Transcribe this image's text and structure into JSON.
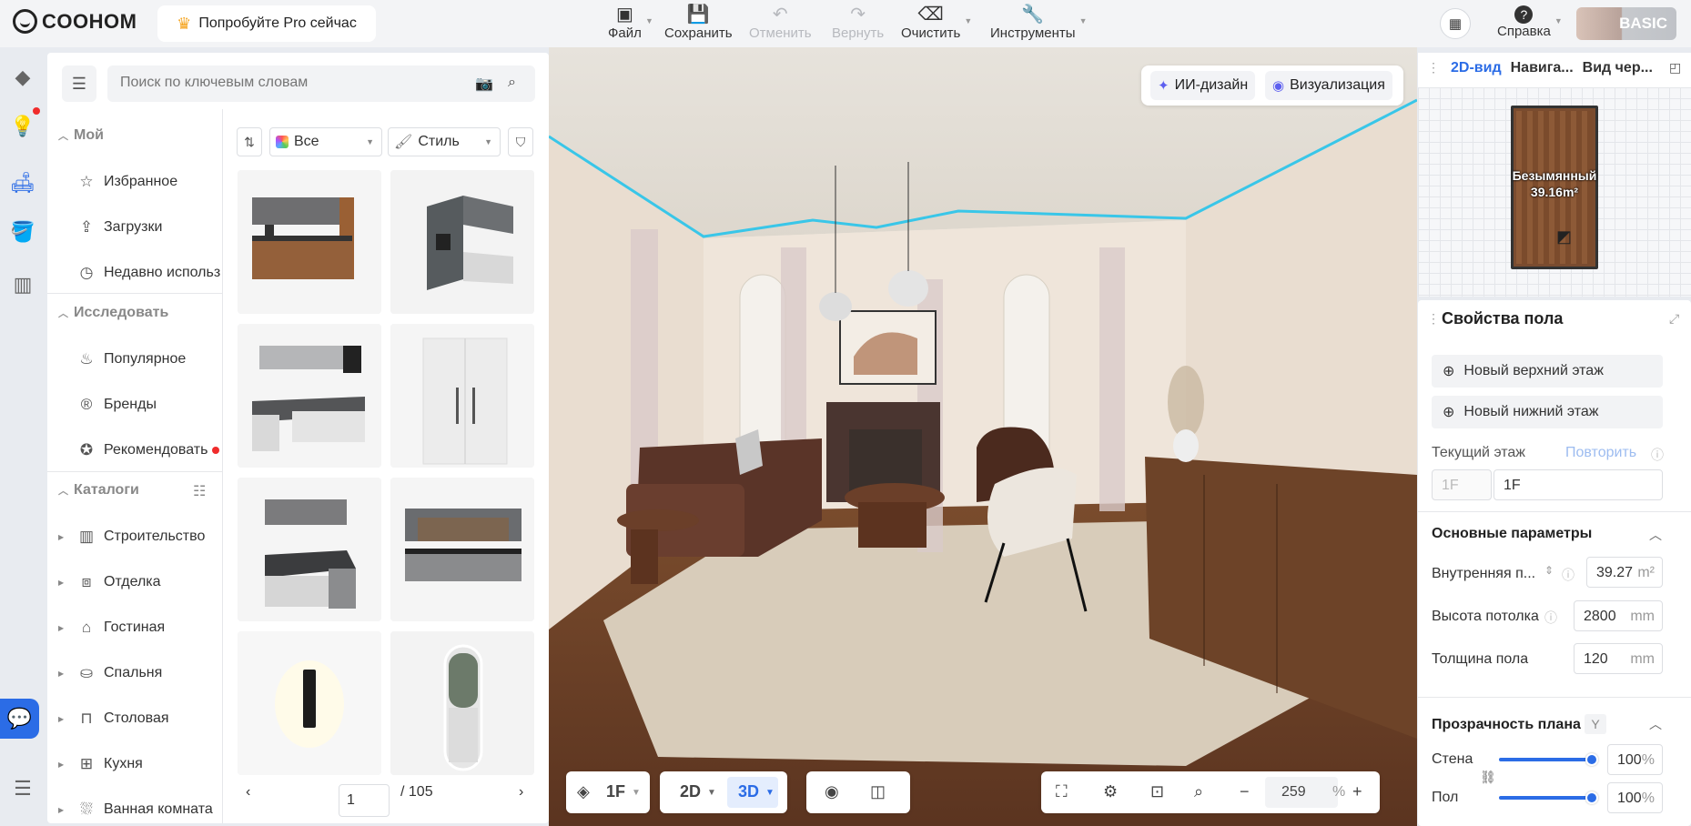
{
  "app": {
    "logo": "COOHOM",
    "pro_label": "Попробуйте Pro сейчас",
    "user_badge": "BASIC"
  },
  "toolbar": {
    "file": "Файл",
    "save": "Сохранить",
    "undo": "Отменить",
    "redo": "Вернуть",
    "clear": "Очистить",
    "tools": "Инструменты",
    "help": "Справка"
  },
  "search": {
    "placeholder": "Поиск по ключевым словам"
  },
  "nav": {
    "my_title": "Мой",
    "my_items": [
      "Избранное",
      "Загрузки",
      "Недавно использ"
    ],
    "explore_title": "Исследовать",
    "explore_items": [
      "Популярное",
      "Бренды",
      "Рекомендовать"
    ],
    "catalog_title": "Каталоги",
    "catalog_items": [
      "Строительство",
      "Отделка",
      "Гостиная",
      "Спальня",
      "Столовая",
      "Кухня",
      "Ванная комната"
    ]
  },
  "filters": {
    "all": "Все",
    "style": "Стиль"
  },
  "pager": {
    "current": "1",
    "total": "/ 105"
  },
  "viewport": {
    "ai_design": "ИИ-дизайн",
    "render": "Визуализация"
  },
  "bottom": {
    "floor": "1F",
    "view2d": "2D",
    "view3d": "3D",
    "zoom": "259",
    "zoom_unit": "%"
  },
  "minimap": {
    "tabs": [
      "2D-вид",
      "Навига...",
      "Вид чер..."
    ],
    "room_name": "Безымянный",
    "room_area": "39.16m²"
  },
  "floor_props": {
    "title": "Свойства пола",
    "new_upper": "Новый верхний этаж",
    "new_lower": "Новый нижний этаж",
    "current_floor_label": "Текущий этаж",
    "repeat": "Повторить",
    "floor_code": "1F",
    "floor_name": "1F",
    "basic_params": "Основные параметры",
    "inner_area_label": "Внутренняя п...",
    "inner_area_value": "39.27",
    "inner_area_unit": "m²",
    "ceiling_label": "Высота потолка",
    "ceiling_value": "2800",
    "ceiling_unit": "mm",
    "thickness_label": "Толщина пола",
    "thickness_value": "120",
    "thickness_unit": "mm",
    "transparency_title": "Прозрачность плана",
    "transparency_key": "Y",
    "wall_label": "Стена",
    "wall_value": "100",
    "floor_label": "Пол",
    "floor_value": "100",
    "pct": "%"
  },
  "colors": {
    "accent": "#2b6ce6",
    "red_dot": "#f02c2c",
    "ai": "#5d5fef"
  }
}
